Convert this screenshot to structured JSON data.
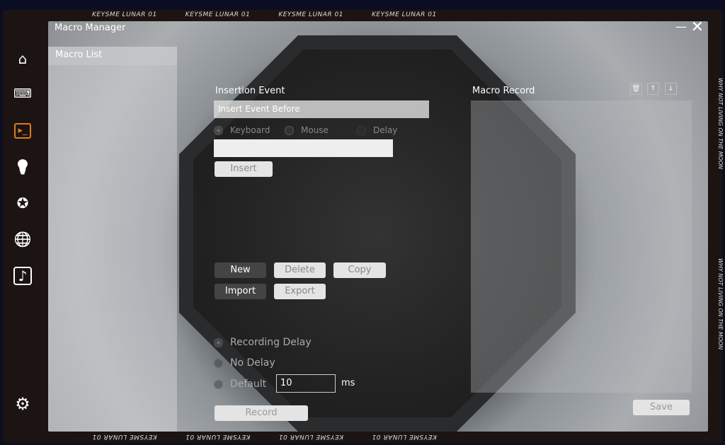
{
  "banner": {
    "text": "KEYSME LUNAR 01",
    "side_text": "WHY NOT LIVING ON THE MOON"
  },
  "window": {
    "title": "Macro Manager",
    "minimize": "—",
    "close": "✕"
  },
  "sidebar": {
    "items": [
      {
        "icon": "home-icon",
        "glyph": "⌂"
      },
      {
        "icon": "keyboard-icon",
        "glyph": "⌨"
      },
      {
        "icon": "terminal-icon",
        "glyph": "▸_",
        "active": true
      },
      {
        "icon": "lightbulb-icon",
        "glyph": "💡"
      },
      {
        "icon": "star-circle-icon",
        "glyph": "✪"
      },
      {
        "icon": "globe-icon",
        "glyph": "🌐"
      },
      {
        "icon": "music-icon",
        "glyph": "♪"
      }
    ],
    "settings": {
      "icon": "gear-icon",
      "glyph": "⚙"
    },
    "accent": "#e07a1f"
  },
  "macro_list": {
    "title": "Macro List"
  },
  "insertion": {
    "title": "Insertion Event",
    "select_value": "Insert Event Before",
    "radios": [
      "Keyboard",
      "Mouse",
      "Delay"
    ],
    "selected": "Keyboard",
    "input_value": "",
    "insert": "Insert"
  },
  "actions": {
    "new": "New",
    "delete": "Delete",
    "copy": "Copy",
    "import": "Import",
    "export": "Export"
  },
  "delay": {
    "options": [
      "Recording Delay",
      "No Delay",
      "Default"
    ],
    "selected": "Recording Delay",
    "default_value": "10",
    "unit": "ms",
    "record": "Record"
  },
  "macro_record": {
    "title": "Macro Record",
    "save": "Save",
    "tools": [
      "trash-icon",
      "arrow-up-icon",
      "arrow-down-icon"
    ]
  }
}
